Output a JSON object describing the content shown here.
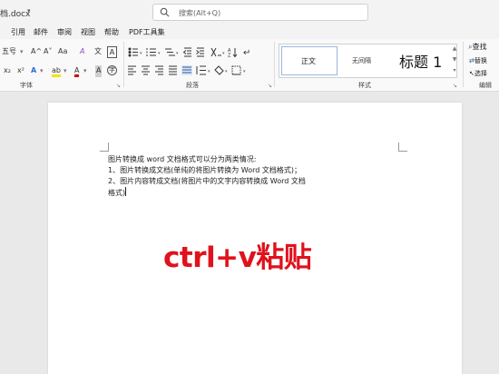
{
  "titlebar": {
    "doc_title": "档.docx",
    "caret": "▾",
    "search_placeholder": "搜索(Alt+Q)"
  },
  "menu": [
    "引用",
    "邮件",
    "审阅",
    "视图",
    "帮助",
    "PDF工具集"
  ],
  "ribbon": {
    "font_name": "五号",
    "font_grow": "A^",
    "font_shrink": "A˅",
    "change_case": "Aa",
    "clear_format": "A",
    "phonetic": "文",
    "subscript": "x₂",
    "superscript": "x²",
    "text_effects": "A",
    "highlight": "ab",
    "font_color": "A",
    "char_shading": "A",
    "enclose": "字",
    "font_group": "字体",
    "paragraph_group": "段落",
    "styles_group": "样式",
    "editing_group": "编辑",
    "styles": {
      "normal": "正文",
      "no_spacing": "无间隔",
      "heading1": "标题 1"
    },
    "editing": {
      "find": "查找",
      "replace": "替换",
      "select": "选择"
    },
    "accent_color": "#2b579a"
  },
  "document": {
    "lines": [
      "图片转换成 word 文档格式可以分为两类情况:",
      "1、图片转换成文档(单纯的将图片转换为 Word 文档格式)；",
      "2、图片内容转成文档(将图片中的文字内容转换成 Word 文档",
      "格式)"
    ],
    "overlay_text": "ctrl+v粘贴",
    "overlay_color": "#e0121c"
  }
}
